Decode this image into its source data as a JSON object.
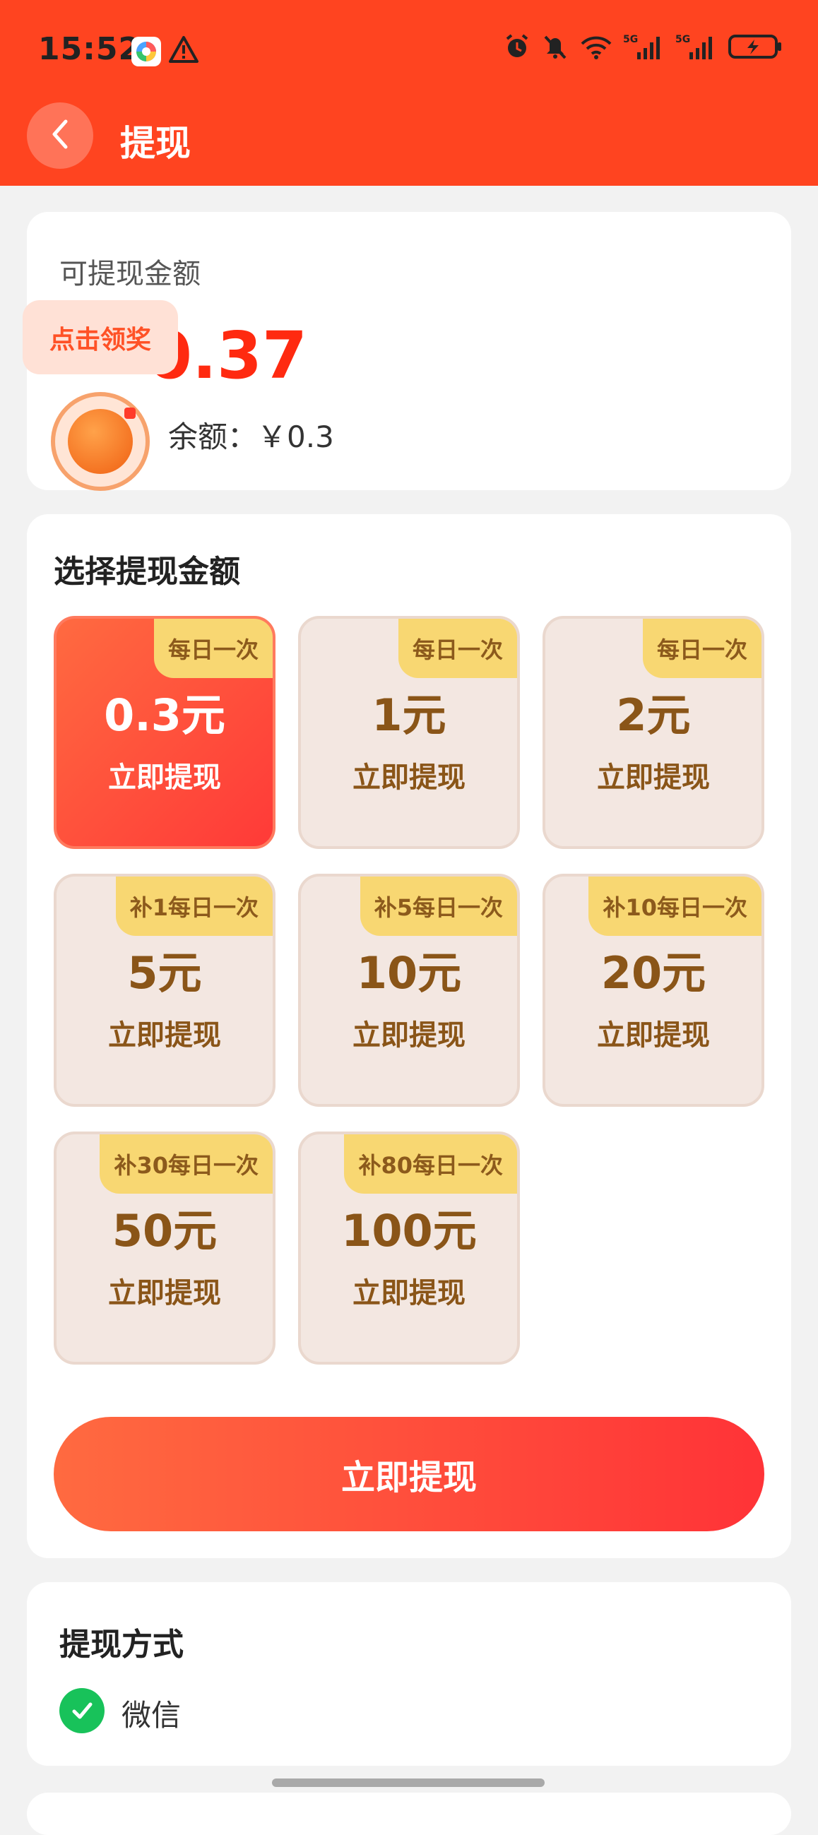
{
  "status_bar": {
    "time": "15:52",
    "icons": [
      "app-icon",
      "warning-icon",
      "alarm-icon",
      "mute-icon",
      "wifi-icon",
      "signal-5g-icon",
      "signal-5g-icon",
      "battery-charging-icon"
    ],
    "network_label_1": "5G",
    "network_label_2": "5G"
  },
  "nav": {
    "title": "提现",
    "back_icon": "chevron-left-icon"
  },
  "balance": {
    "label": "可提现金额",
    "value": "0.37",
    "sub_label": "余额：￥0.3"
  },
  "reward_float": {
    "label": "点击领奖"
  },
  "select_amount": {
    "title": "选择提现金额",
    "options": [
      {
        "tag": "每日一次",
        "amount": "0.3元",
        "action": "立即提现",
        "selected": true
      },
      {
        "tag": "每日一次",
        "amount": "1元",
        "action": "立即提现",
        "selected": false
      },
      {
        "tag": "每日一次",
        "amount": "2元",
        "action": "立即提现",
        "selected": false
      },
      {
        "tag": "补1每日一次",
        "amount": "5元",
        "action": "立即提现",
        "selected": false
      },
      {
        "tag": "补5每日一次",
        "amount": "10元",
        "action": "立即提现",
        "selected": false
      },
      {
        "tag": "补10每日一次",
        "amount": "20元",
        "action": "立即提现",
        "selected": false
      },
      {
        "tag": "补30每日一次",
        "amount": "50元",
        "action": "立即提现",
        "selected": false
      },
      {
        "tag": "补80每日一次",
        "amount": "100元",
        "action": "立即提现",
        "selected": false
      }
    ],
    "submit_label": "立即提现"
  },
  "method": {
    "title": "提现方式",
    "option_label": "微信",
    "option_icon": "check-circle-icon"
  },
  "colors": {
    "header": "#ff4420",
    "accent": "#ff3a38",
    "tile_bg": "#f3e7e1",
    "tag_bg": "#f8d772",
    "tile_text": "#8a5518",
    "wechat_green": "#18c25a"
  }
}
